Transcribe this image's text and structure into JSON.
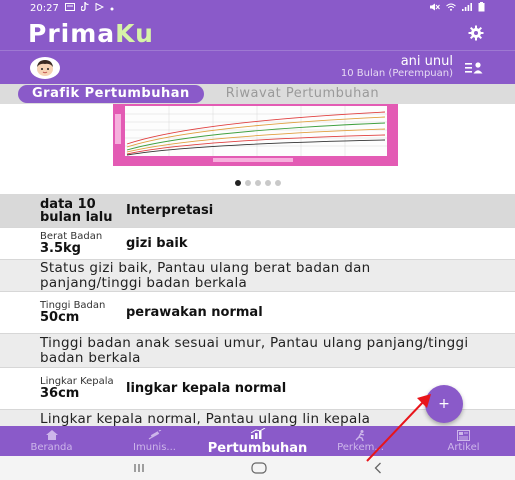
{
  "status_bar": {
    "time": "20:27",
    "left_icons": [
      "message-icon",
      "tiktok-icon",
      "play-icon"
    ],
    "right_icons": [
      "mute-icon",
      "wifi-icon",
      "signal-icon",
      "battery-icon"
    ]
  },
  "app": {
    "brand_prefix": "Prima",
    "brand_suffix": "Ku",
    "brand_color": "#8a5ac9",
    "brand_accent": "#d6f3a8"
  },
  "profile": {
    "name": "ani unul",
    "age": "10 Bulan (Perempuan)"
  },
  "tabs": [
    {
      "label": "Grafik Pertumbuhan",
      "active": true
    },
    {
      "label": "Riwavat Pertumbuhan",
      "active": false
    }
  ],
  "carousel": {
    "page_count": 5,
    "active_index": 0
  },
  "table": {
    "header_left": "data 10 bulan lalu",
    "header_right": "Interpretasi",
    "sections": [
      {
        "label": "Berat Badan",
        "value": "3.5kg",
        "interpretation": "gizi baik",
        "description": "Status gizi baik, Pantau ulang berat badan dan panjang/tinggi badan berkala"
      },
      {
        "label": "Tinggi Badan",
        "value": "50cm",
        "interpretation": "perawakan normal",
        "description": "Tinggi badan anak sesuai umur, Pantau ulang panjang/tinggi badan berkala"
      },
      {
        "label": "Lingkar Kepala",
        "value": "36cm",
        "interpretation": "lingkar kepala normal",
        "description": "Lingkar kepala normal, Pantau ulang lin kepala berkala"
      }
    ]
  },
  "fab": {
    "label": "+"
  },
  "bottom_nav": [
    {
      "label": "Beranda",
      "icon": "home-icon",
      "active": false
    },
    {
      "label": "Imunis...",
      "icon": "syringe-icon",
      "active": false
    },
    {
      "label": "Pertumbuhan",
      "icon": "growth-icon",
      "active": true
    },
    {
      "label": "Perkem...",
      "icon": "child-run-icon",
      "active": false
    },
    {
      "label": "Artikel",
      "icon": "article-icon",
      "active": false
    }
  ],
  "annotation": {
    "arrow_color": "#e8151b"
  }
}
